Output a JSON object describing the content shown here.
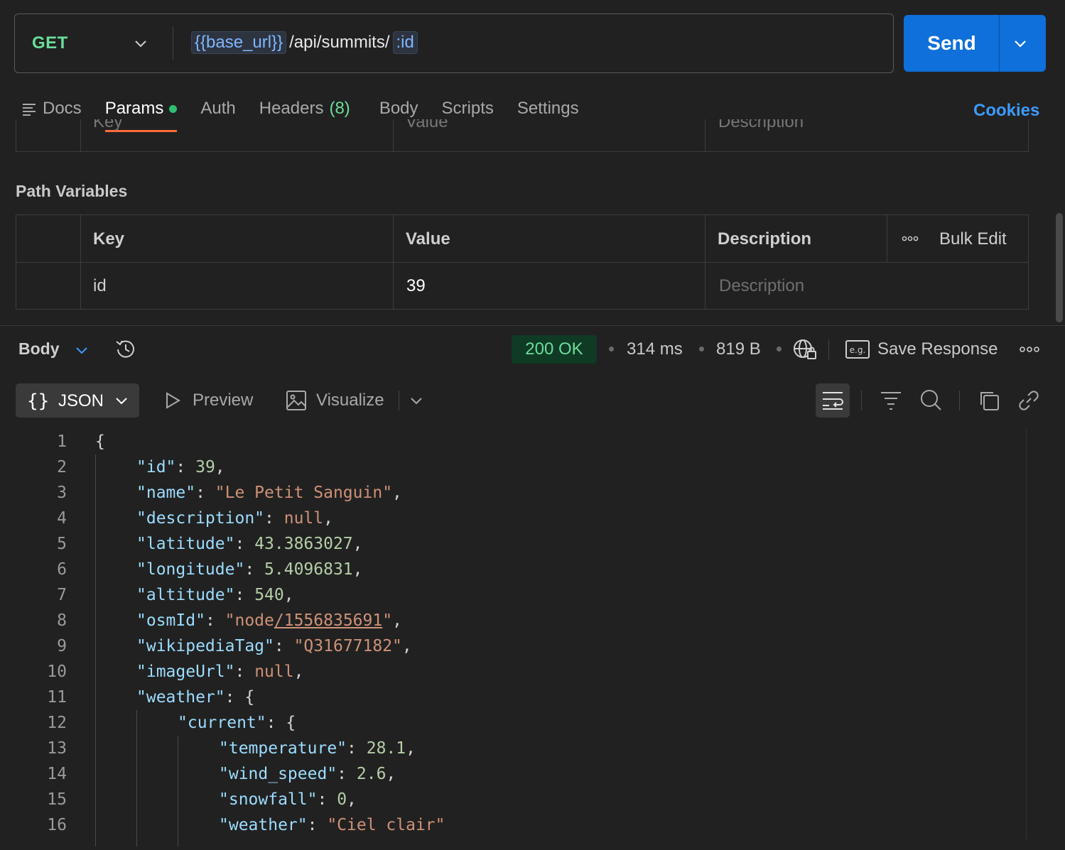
{
  "request": {
    "method": "GET",
    "url_var": "{{base_url}}",
    "url_path": "/api/summits/",
    "url_param": ":id",
    "send_label": "Send"
  },
  "tabs": {
    "docs": "Docs",
    "params": "Params",
    "auth": "Auth",
    "headers": "Headers",
    "headers_count": "(8)",
    "body": "Body",
    "scripts": "Scripts",
    "settings": "Settings",
    "cookies": "Cookies"
  },
  "query_params": {
    "key_header": "Key",
    "value_header": "Value",
    "description_header": "Description"
  },
  "path_variables": {
    "title": "Path Variables",
    "key_header": "Key",
    "value_header": "Value",
    "description_header": "Description",
    "bulk_edit": "Bulk Edit",
    "rows": [
      {
        "key": "id",
        "value": "39",
        "description_placeholder": "Description"
      }
    ]
  },
  "response": {
    "body_label": "Body",
    "status": "200 OK",
    "time": "314 ms",
    "size": "819 B",
    "save_response": "Save Response",
    "format": "JSON",
    "preview": "Preview",
    "visualize": "Visualize"
  },
  "code_lines": [
    "1",
    "2",
    "3",
    "4",
    "5",
    "6",
    "7",
    "8",
    "9",
    "10",
    "11",
    "12",
    "13",
    "14",
    "15",
    "16"
  ],
  "json_body": {
    "id_key": "\"id\"",
    "id_val": "39",
    "name_key": "\"name\"",
    "name_val": "\"Le Petit Sanguin\"",
    "description_key": "\"description\"",
    "description_val": "null",
    "latitude_key": "\"latitude\"",
    "latitude_val": "43.3863027",
    "longitude_key": "\"longitude\"",
    "longitude_val": "5.4096831",
    "altitude_key": "\"altitude\"",
    "altitude_val": "540",
    "osmId_key": "\"osmId\"",
    "osmId_prefix": "\"node",
    "osmId_link": "/1556835691",
    "osmId_suffix": "\"",
    "wikipediaTag_key": "\"wikipediaTag\"",
    "wikipediaTag_val": "\"Q31677182\"",
    "imageUrl_key": "\"imageUrl\"",
    "imageUrl_val": "null",
    "weather_key": "\"weather\"",
    "current_key": "\"current\"",
    "temperature_key": "\"temperature\"",
    "temperature_val": "28.1",
    "wind_speed_key": "\"wind_speed\"",
    "wind_speed_val": "2.6",
    "snowfall_key": "\"snowfall\"",
    "snowfall_val": "0",
    "weather_inner_key": "\"weather\"",
    "weather_inner_val": "\"Ciel clair\""
  },
  "colors": {
    "method": "#6bdd9a",
    "send": "#0f6fdb",
    "active_tab_underline": "#ff6c37",
    "cookies": "#3b9bff",
    "status_bg": "#0f3a24"
  },
  "icons": [
    "chevron-down-icon",
    "docs-icon",
    "history-icon",
    "globe-lock-icon",
    "example-icon",
    "more-icon",
    "play-icon",
    "image-icon",
    "wrap-icon",
    "filter-icon",
    "search-icon",
    "copy-icon",
    "link-icon"
  ]
}
